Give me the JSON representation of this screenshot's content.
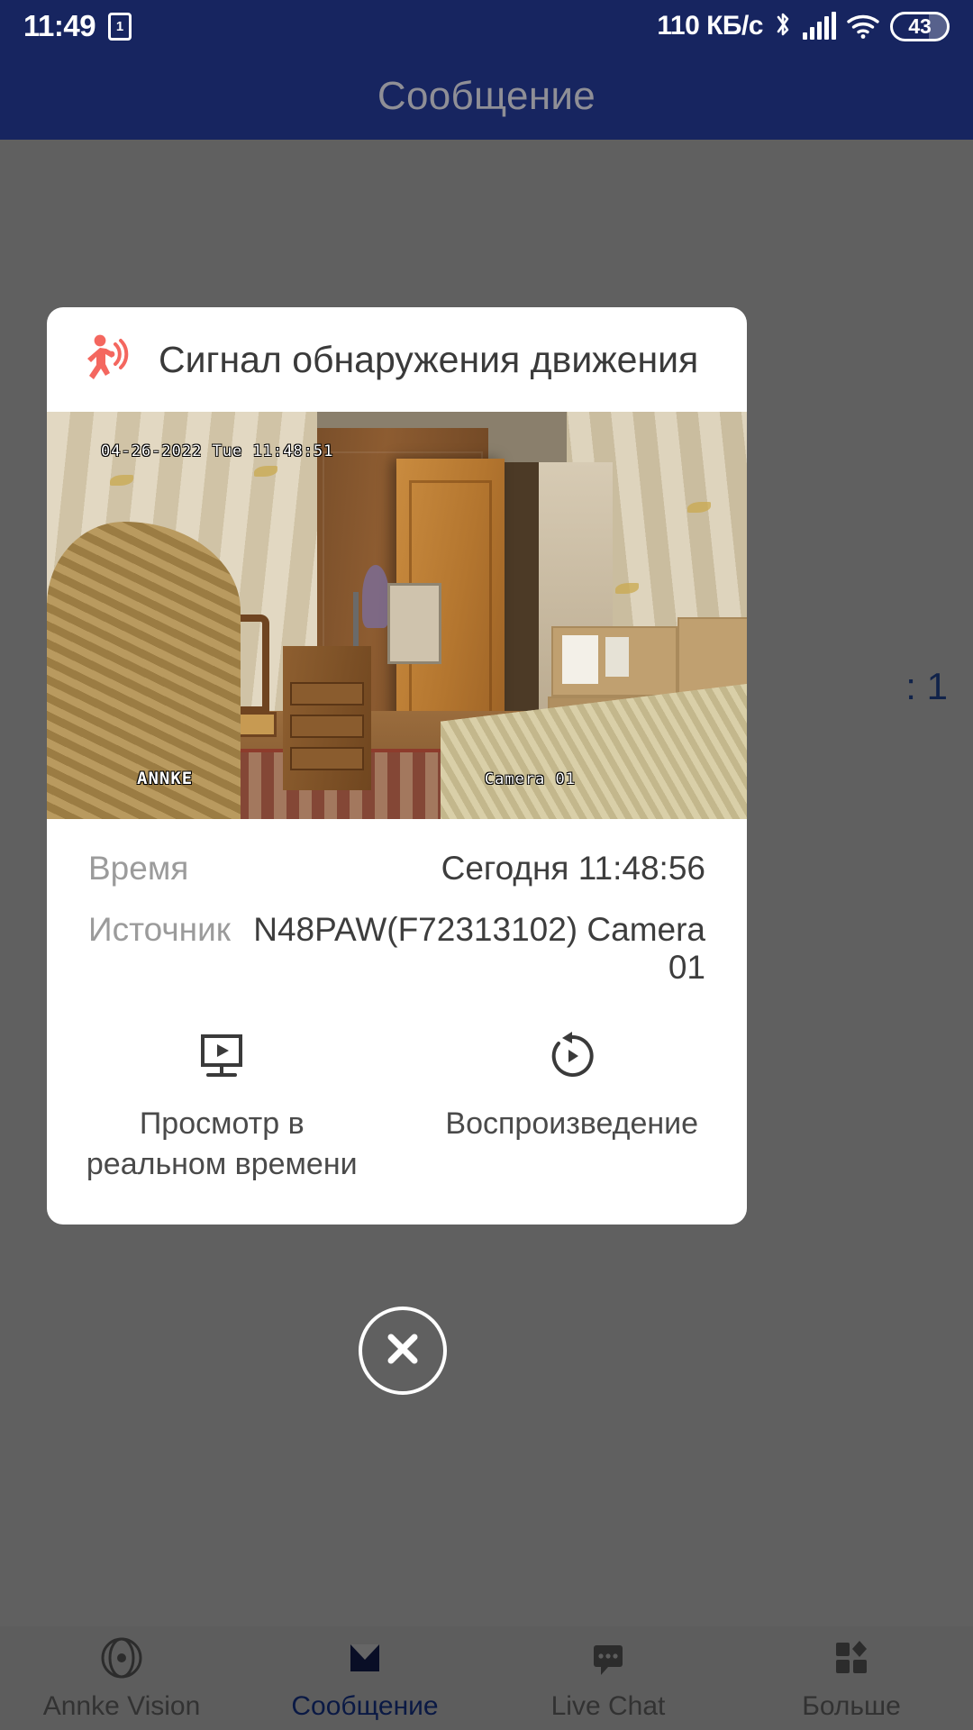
{
  "status_bar": {
    "time": "11:49",
    "sim_badge": "1",
    "data_rate": "110 КБ/с",
    "battery_percent": "43",
    "icons": [
      "sim-card-icon",
      "bluetooth-icon",
      "cellular-signal-icon",
      "wifi-icon",
      "battery-icon"
    ]
  },
  "app_bar": {
    "title": "Сообщение"
  },
  "background": {
    "partial_row_text": ": 1"
  },
  "dialog": {
    "title": "Сигнал обнаружения движения",
    "icon": "motion-detection-icon",
    "snapshot": {
      "osd_timestamp": "04-26-2022 Tue 11:48:51",
      "watermark": "ANNKE",
      "camera_label": "Camera 01"
    },
    "info": [
      {
        "label": "Время",
        "value": "Сегодня 11:48:56"
      },
      {
        "label": "Источник",
        "value": "N48PAW(F72313102) Camera 01"
      }
    ],
    "actions": [
      {
        "label": "Просмотр в реальном времени",
        "icon": "live-view-monitor-icon"
      },
      {
        "label": "Воспроизведение",
        "icon": "playback-replay-icon"
      }
    ]
  },
  "close_button": {
    "icon": "close-x-icon"
  },
  "bottom_nav": {
    "items": [
      {
        "label": "Annke Vision",
        "icon": "camera-lens-icon",
        "active": false
      },
      {
        "label": "Сообщение",
        "icon": "envelope-icon",
        "active": true
      },
      {
        "label": "Live Chat",
        "icon": "chat-bubble-icon",
        "active": false
      },
      {
        "label": "Больше",
        "icon": "grid-more-icon",
        "active": false
      }
    ]
  },
  "colors": {
    "app_bar": "#172560",
    "accent": "#1b3faa",
    "alert": "#f4675f",
    "scrim": "rgba(0,0,0,0.60)"
  }
}
